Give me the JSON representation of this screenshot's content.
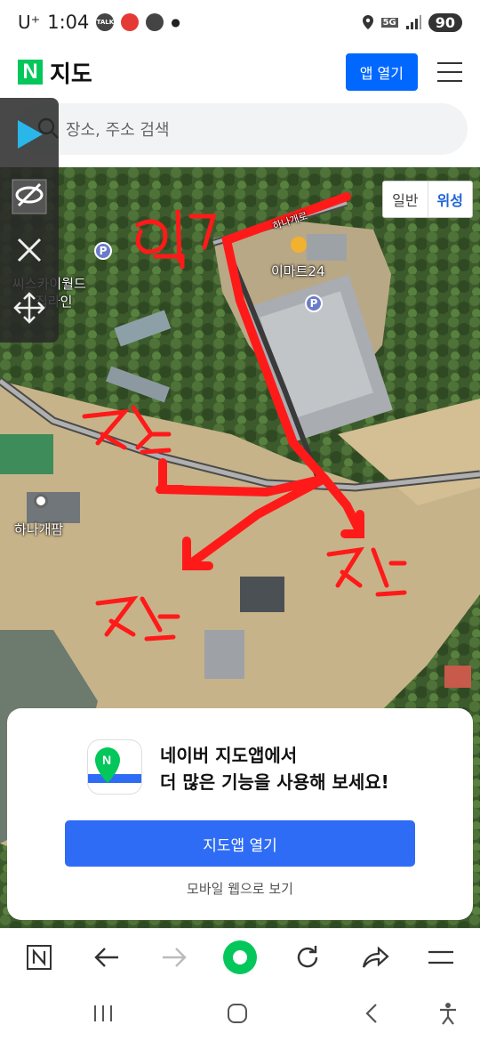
{
  "status_bar": {
    "carrier": "U⁺",
    "time": "1:04",
    "talk_icon_text": "TALK",
    "network": "5G",
    "battery": "90"
  },
  "header": {
    "logo_letter": "N",
    "title": "지도",
    "open_app_label": "앱 열기"
  },
  "search": {
    "placeholder": "장소, 주소 검색"
  },
  "map": {
    "type_toggle": {
      "normal": "일반",
      "satellite": "위성",
      "selected": "위성"
    },
    "pois": [
      {
        "name": "이마트24"
      },
      {
        "name": "씨스카이월드"
      },
      {
        "name": "집라인"
      },
      {
        "name": "하나개팜"
      }
    ],
    "road_label": "하나개로",
    "annotations": [
      "입구",
      "주차",
      "주차",
      "주차"
    ],
    "colors": {
      "annotation": "#ff1a1a",
      "forest": "#3f5e2f",
      "sand": "#c9b48a"
    }
  },
  "sheet": {
    "message_line1": "네이버 지도앱에서",
    "message_line2": "더 많은 기능을 사용해 보세요!",
    "open_button": "지도앱 열기",
    "web_link": "모바일 웹으로 보기"
  },
  "toolbar": {
    "items": [
      "n-home-icon",
      "back-arrow-icon",
      "forward-arrow-icon",
      "home-icon",
      "refresh-icon",
      "share-icon",
      "menu-icon"
    ]
  },
  "accent": "#03c75a"
}
